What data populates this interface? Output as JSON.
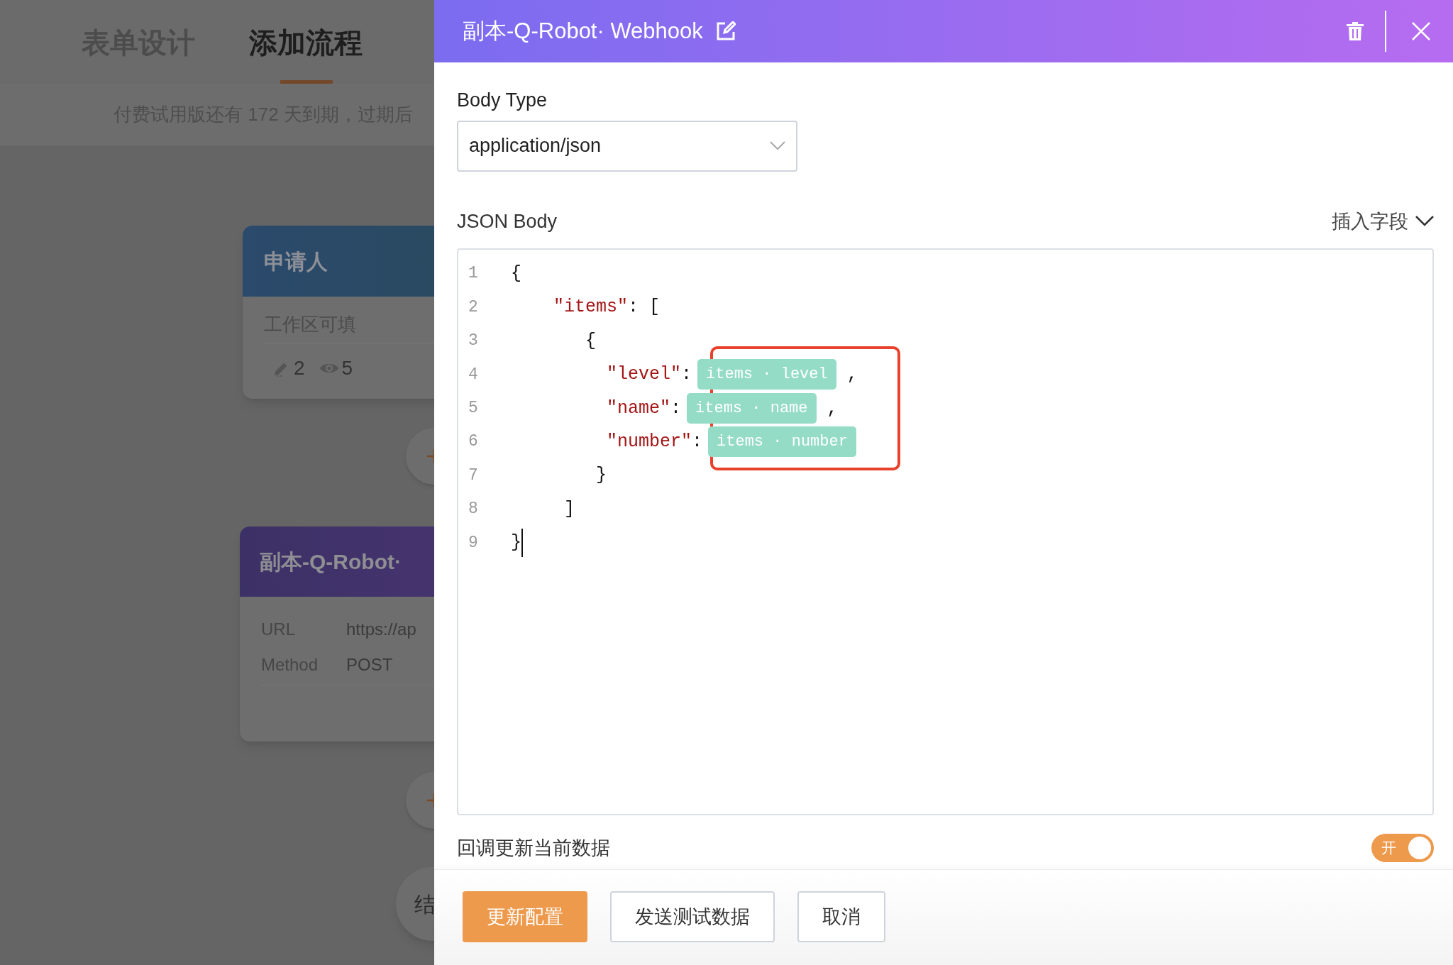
{
  "background": {
    "tabs": [
      {
        "label": "表单设计",
        "selected": false
      },
      {
        "label": "添加流程",
        "selected": true
      }
    ],
    "notice": "付费试用版还有 172 天到期，过期后",
    "nodes": [
      {
        "kind": "approver",
        "title": "申请人",
        "subtitle": "工作区可填",
        "edit_count": "2",
        "view_count": "5"
      },
      {
        "kind": "webhook",
        "title": "副本-Q-Robot·",
        "fields": [
          {
            "label": "URL",
            "value": "https://ap"
          },
          {
            "label": "Method",
            "value": "POST"
          }
        ]
      },
      {
        "kind": "end",
        "title": "结"
      }
    ]
  },
  "drawer": {
    "title": "副本-Q-Robot· Webhook",
    "body_type_label": "Body Type",
    "body_type": "application/json",
    "json_body_label": "JSON Body",
    "insert_field": "插入字段",
    "code_lines": [
      {
        "number": "1",
        "cursor": false,
        "segments": [
          {
            "kind": "punct",
            "text": "{"
          }
        ]
      },
      {
        "number": "2",
        "cursor": false,
        "segments": [
          {
            "kind": "key",
            "text": "    \"items\""
          },
          {
            "kind": "punct",
            "text": ": ["
          }
        ]
      },
      {
        "number": "3",
        "cursor": false,
        "segments": [
          {
            "kind": "punct",
            "text": "       {"
          }
        ]
      },
      {
        "number": "4",
        "cursor": false,
        "segments": [
          {
            "kind": "key",
            "text": "         \"level\""
          },
          {
            "kind": "punct",
            "text": ":"
          },
          {
            "kind": "field",
            "text": "items · level"
          },
          {
            "kind": "punct",
            "text": " ,"
          }
        ]
      },
      {
        "number": "5",
        "cursor": false,
        "segments": [
          {
            "kind": "key",
            "text": "         \"name\""
          },
          {
            "kind": "punct",
            "text": ":"
          },
          {
            "kind": "field",
            "text": "items · name"
          },
          {
            "kind": "punct",
            "text": " ,"
          }
        ]
      },
      {
        "number": "6",
        "cursor": false,
        "segments": [
          {
            "kind": "key",
            "text": "         \"number\""
          },
          {
            "kind": "punct",
            "text": ":"
          },
          {
            "kind": "field",
            "text": "items · number"
          }
        ]
      },
      {
        "number": "7",
        "cursor": false,
        "segments": [
          {
            "kind": "punct",
            "text": "        }"
          }
        ]
      },
      {
        "number": "8",
        "cursor": false,
        "segments": [
          {
            "kind": "punct",
            "text": "     ]"
          }
        ]
      },
      {
        "number": "9",
        "cursor": true,
        "segments": [
          {
            "kind": "punct",
            "text": "}"
          }
        ]
      }
    ],
    "callback": {
      "label": "回调更新当前数据",
      "on": true,
      "on_text": "开"
    },
    "buttons": [
      {
        "label": "更新配置",
        "kind": "primary"
      },
      {
        "label": "发送测试数据",
        "kind": "default"
      },
      {
        "label": "取消",
        "kind": "default"
      }
    ]
  }
}
